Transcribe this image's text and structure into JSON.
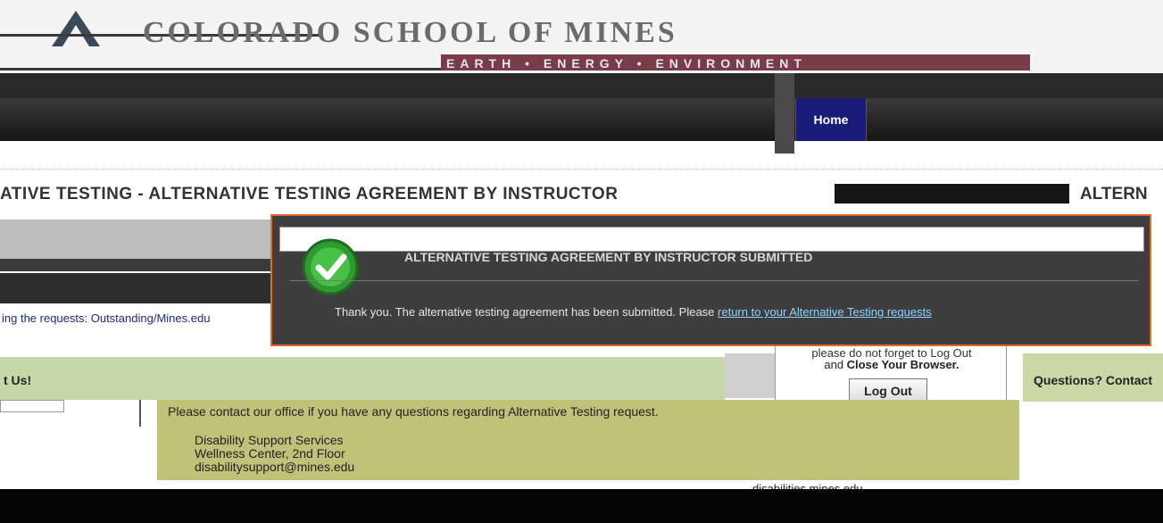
{
  "header": {
    "college_name": "COLORADO SCHOOL OF MINES",
    "tagline": "EARTH • ENERGY • ENVIRONMENT",
    "brand_color": "#7a3b4a"
  },
  "nav": {
    "home_label": "Home",
    "active_color": "#1a1a7a"
  },
  "page": {
    "title": "ATIVE TESTING - ALTERNATIVE TESTING AGREEMENT BY INSTRUCTOR",
    "title_right": "ALTERN",
    "submitted_text": "ing the requests: Outstanding/Mines.edu"
  },
  "modal": {
    "title": "ALTERNATIVE TESTING AGREEMENT BY INSTRUCTOR SUBMITTED",
    "message": "Thank you. The alternative testing agreement has been submitted. Please ",
    "link_text": "return to your Alternative Testing requests",
    "icon": "success-check-icon",
    "border_color": "#e06a2a"
  },
  "logout": {
    "note": "please do not forget to Log Out",
    "line2_pre": "and ",
    "line2_bold": "Close Your Browser.",
    "button_label": "Log Out"
  },
  "contact": {
    "left_heading": "t Us!",
    "right_heading": "Questions? Contact",
    "message": "Please contact our office if you have any questions regarding Alternative Testing request.",
    "address_line1": "Disability Support Services",
    "address_line2": "Wellness Center, 2nd Floor",
    "address_line3": "disabilitysupport@mines.edu",
    "website": "disabilities.mines.edu"
  }
}
